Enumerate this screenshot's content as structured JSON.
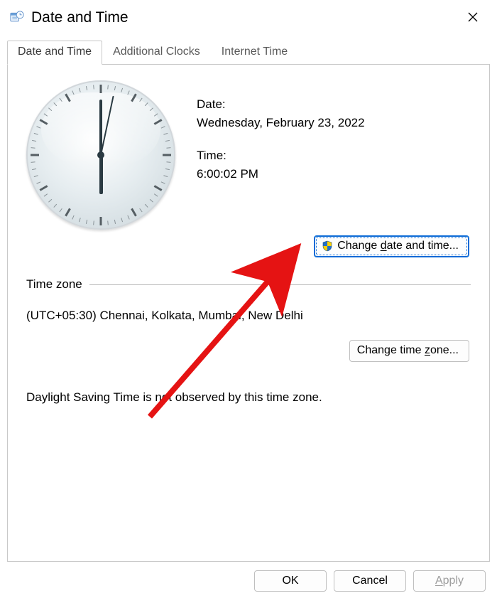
{
  "window": {
    "title": "Date and Time"
  },
  "tabs": [
    {
      "label": "Date and Time",
      "active": true
    },
    {
      "label": "Additional Clocks",
      "active": false
    },
    {
      "label": "Internet Time",
      "active": false
    }
  ],
  "datetime": {
    "date_label": "Date:",
    "date_value": "Wednesday, February 23, 2022",
    "time_label": "Time:",
    "time_value": "6:00:02 PM",
    "change_dt_button_pre": "Change ",
    "change_dt_button_u": "d",
    "change_dt_button_post": "ate and time..."
  },
  "timezone": {
    "section_label": "Time zone",
    "value": "(UTC+05:30) Chennai, Kolkata, Mumbai, New Delhi",
    "change_tz_button_pre": "Change time ",
    "change_tz_button_u": "z",
    "change_tz_button_post": "one...",
    "dst_note": "Daylight Saving Time is not observed by this time zone."
  },
  "footer": {
    "ok": "OK",
    "cancel": "Cancel",
    "apply_u": "A",
    "apply_post": "pply"
  },
  "clock": {
    "hour": 6,
    "minute": 0,
    "second": 2
  }
}
